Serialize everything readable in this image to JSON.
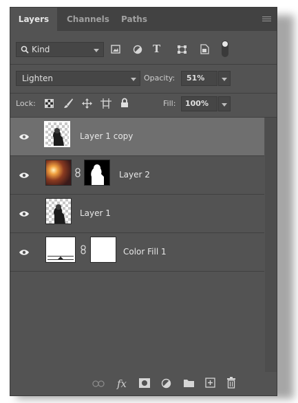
{
  "tabs": [
    {
      "label": "Layers",
      "active": true
    },
    {
      "label": "Channels",
      "active": false
    },
    {
      "label": "Paths",
      "active": false
    }
  ],
  "filter": {
    "kind_label": "Kind",
    "icons": [
      "image-filter-icon",
      "adjustment-filter-icon",
      "type-filter-icon",
      "shape-filter-icon",
      "smart-object-filter-icon",
      "filter-toggle-icon"
    ]
  },
  "blend": {
    "mode": "Lighten",
    "opacity_label": "Opacity:",
    "opacity_value": "51%"
  },
  "lock": {
    "label": "Lock:",
    "icons": [
      "lock-transparent-pixels-icon",
      "lock-image-pixels-icon",
      "lock-position-icon",
      "lock-artboard-icon",
      "lock-all-icon"
    ],
    "fill_label": "Fill:",
    "fill_value": "100%"
  },
  "layers": [
    {
      "name": "Layer 1 copy",
      "selected": true,
      "visible": true,
      "thumb": "photo-transparent",
      "mask": false
    },
    {
      "name": "Layer 2",
      "selected": false,
      "visible": true,
      "thumb": "photo-fire",
      "mask": true
    },
    {
      "name": "Layer 1",
      "selected": false,
      "visible": true,
      "thumb": "photo-transparent",
      "mask": false
    },
    {
      "name": "Color Fill 1",
      "selected": false,
      "visible": true,
      "thumb": "solid-fill",
      "mask": true
    }
  ],
  "footer_icons": [
    "link-layers-icon",
    "layer-style-icon",
    "add-mask-icon",
    "new-adjustment-icon",
    "new-group-icon",
    "new-layer-icon",
    "delete-layer-icon"
  ],
  "footer_fx_label": "fx",
  "colors": {
    "panel_bg": "#535353",
    "tab_bar": "#424242",
    "selected_layer": "#6f6f6f",
    "text": "#e0e0e0"
  }
}
